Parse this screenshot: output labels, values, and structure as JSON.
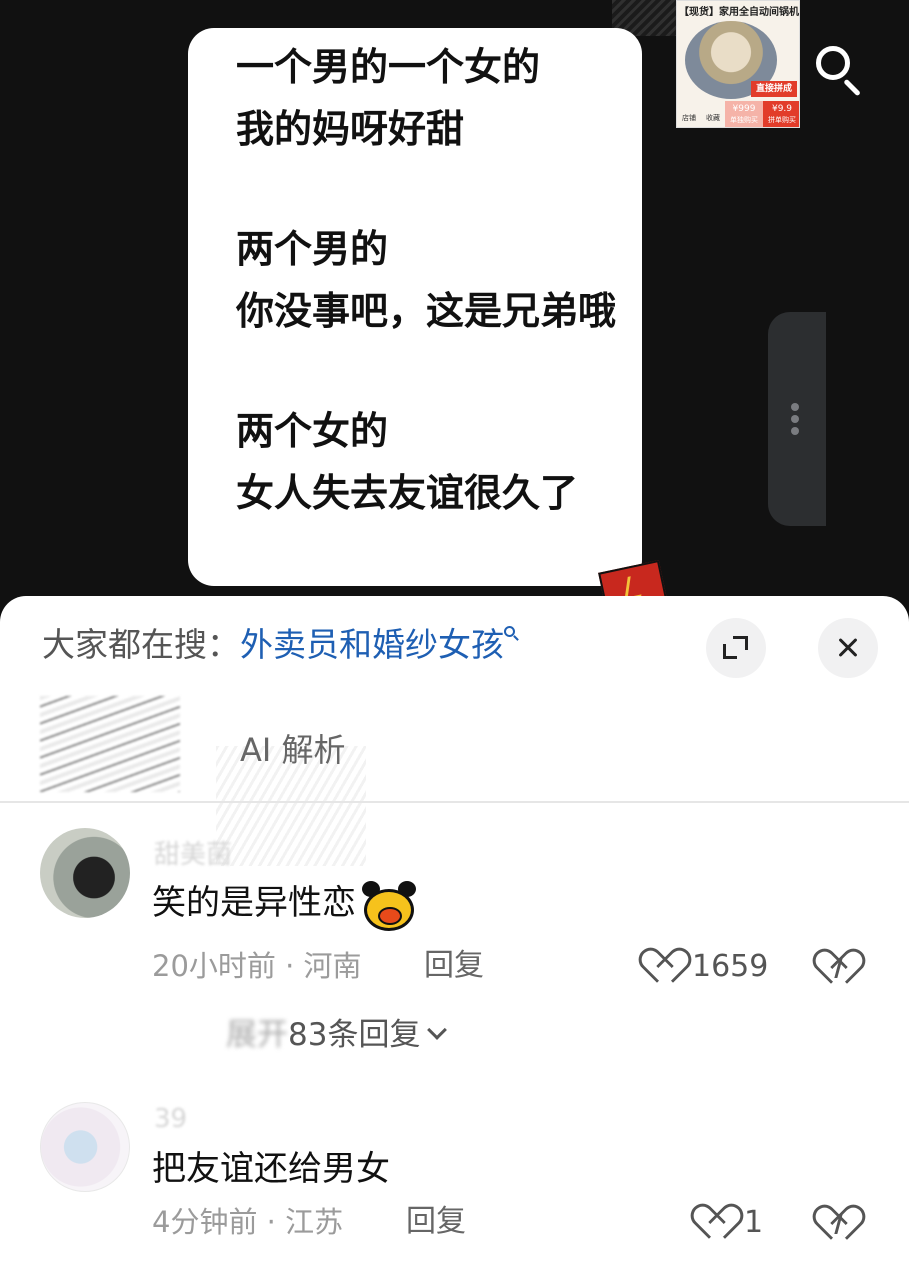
{
  "video": {
    "bubble_lines": [
      "一个男的一个女的",
      "我的妈呀好甜",
      "",
      "两个男的",
      "你没事吧，这是兄弟哦",
      "",
      "两个女的",
      "女人失去友谊很久了"
    ]
  },
  "ad": {
    "title": "【现货】家用全自动间锅机",
    "ribbon": "直接拼成",
    "store_label": "店铺",
    "fav_label": "收藏",
    "price_1": "¥999",
    "buy_1": "单独购买",
    "price_2": "¥9.9",
    "buy_2": "拼单购买"
  },
  "icons": {
    "search": "search-icon",
    "more": "more-vertical-icon",
    "expand": "expand-icon",
    "close": "close-icon",
    "like": "heart-icon",
    "dislike": "broken-heart-icon",
    "chevron": "chevron-down-icon"
  },
  "sheet": {
    "hot_prefix": "大家都在搜：",
    "hot_query": "外卖员和婚纱女孩",
    "ai_tab": "AI 解析",
    "link_color": "#1e5fb3"
  },
  "comments": [
    {
      "username": "甜美菌",
      "text": "笑的是异性恋",
      "time_location": "20小时前 · 河南",
      "reply_label": "回复",
      "likes": "1659",
      "expand_label_blur": "展开",
      "expand_label": "83条回复"
    },
    {
      "username": "39",
      "text": "把友谊还给男女",
      "time_location": "4分钟前 · 江苏",
      "reply_label": "回复",
      "likes": "1"
    }
  ]
}
